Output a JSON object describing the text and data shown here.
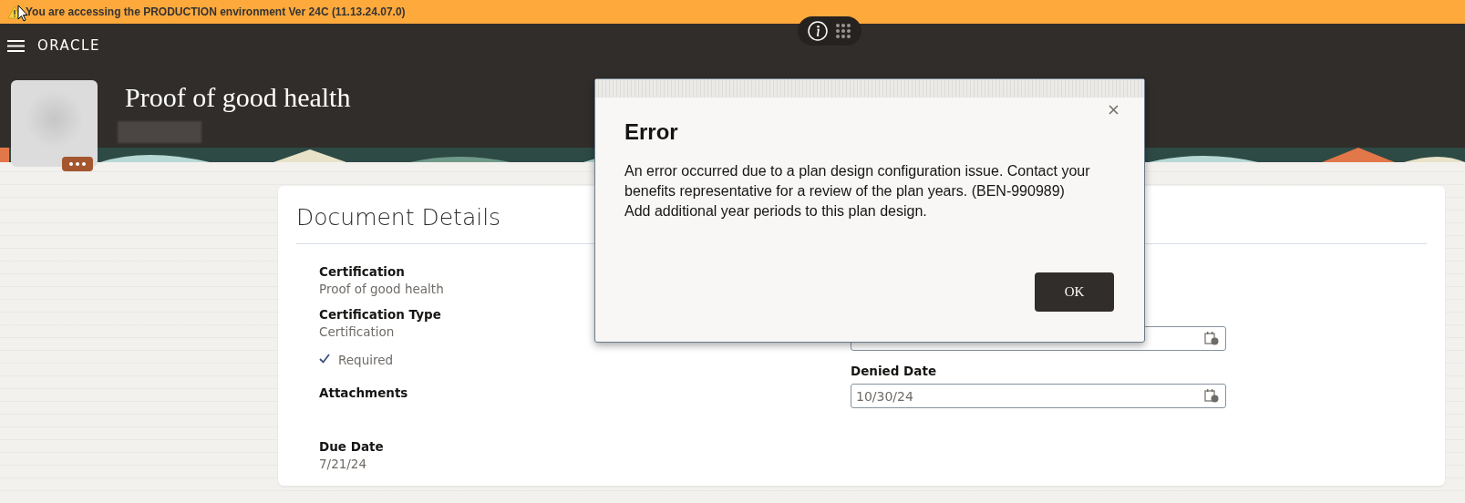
{
  "banner": {
    "text": "You are accessing the PRODUCTION environment Ver 24C (11.13.24.07.0)"
  },
  "header": {
    "logo": "ORACLE",
    "title": "Proof of good health"
  },
  "card": {
    "title": "Document Details",
    "left": [
      {
        "kind": "field",
        "label": "Certification",
        "value": "Proof of good health"
      },
      {
        "kind": "field",
        "label": "Certification Type",
        "value": "Certification"
      },
      {
        "kind": "check",
        "label": "Required",
        "checked": true
      },
      {
        "kind": "field",
        "label": "Attachments"
      },
      {
        "kind": "field",
        "label": "Due Date",
        "value": "7/21/24"
      }
    ],
    "right": [
      {
        "kind": "date"
      },
      {
        "kind": "date",
        "label": "Denied Date",
        "value": "10/30/24"
      }
    ]
  },
  "dialog": {
    "title": "Error",
    "message": "An error occurred due to a plan design configuration issue. Contact your benefits representative for a review of the plan years. (BEN-990989)",
    "detail": "Add additional year periods to this plan design.",
    "buttons": [
      "OK"
    ]
  }
}
